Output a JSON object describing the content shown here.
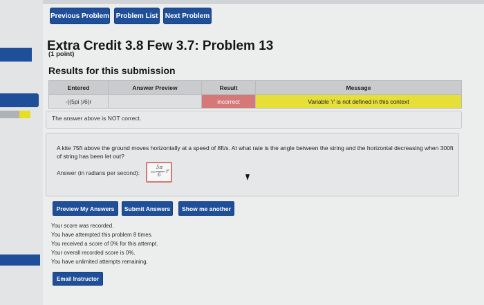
{
  "nav": {
    "previous_label": "Previous Problem",
    "list_label": "Problem List",
    "next_label": "Next Problem"
  },
  "header": {
    "title": "Extra Credit 3.8 Few 3.7: Problem 13",
    "points": "(1 point)"
  },
  "results": {
    "heading": "Results for this submission",
    "columns": [
      "Entered",
      "Answer Preview",
      "Result",
      "Message"
    ],
    "row": {
      "entered": "-((5pi )/6)r",
      "preview": "",
      "result": "incorrect",
      "message": "Variable 'r' is not defined in this context"
    },
    "status_text": "The answer above is NOT correct."
  },
  "problem": {
    "text": "A kite 75ft above the ground moves horizontally at a speed of 8ft/s. At what rate is the angle between the string and the horizontal decreasing when 300ft of string has been let out?",
    "answer_label": "Answer (in radians per second):",
    "answer_minus": "−",
    "answer_numerator": "5π",
    "answer_denominator": "6",
    "answer_variable": "r"
  },
  "actions": {
    "preview_label": "Preview My Answers",
    "submit_label": "Submit Answers",
    "show_another_label": "Show me another"
  },
  "score": {
    "line1": "Your score was recorded.",
    "line2": "You have attempted this problem 8 times.",
    "line3": "You received a score of 0% for this attempt.",
    "line4": "Your overall recorded score is 0%.",
    "line5": "You have unlimited attempts remaining."
  },
  "footer": {
    "email_label": "Email Instructor"
  },
  "colors": {
    "accent": "#1f4f98",
    "incorrect": "#d47878",
    "message_bg": "#e6df38"
  }
}
